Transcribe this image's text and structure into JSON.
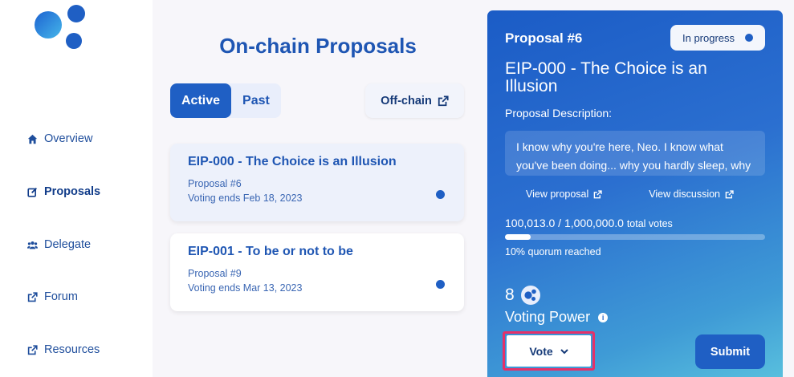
{
  "sidebar": {
    "logo_icon": "logo-circles-icon",
    "items": [
      {
        "label": "Overview",
        "icon": "home-icon"
      },
      {
        "label": "Proposals",
        "icon": "edit-icon",
        "active": true
      },
      {
        "label": "Delegate",
        "icon": "users-icon"
      },
      {
        "label": "Forum",
        "icon": "external-link-icon"
      },
      {
        "label": "Resources",
        "icon": "external-link-icon"
      }
    ]
  },
  "main": {
    "title": "On-chain Proposals",
    "tabs": [
      {
        "label": "Active",
        "active": true
      },
      {
        "label": "Past",
        "active": false
      }
    ],
    "offchain_label": "Off-chain",
    "proposals": [
      {
        "title": "EIP-000 - The Choice is an Illusion",
        "number": "Proposal #6",
        "ends": "Voting ends Feb 18, 2023",
        "selected": true
      },
      {
        "title": "EIP-001 - To be or not to be",
        "number": "Proposal #9",
        "ends": "Voting ends Mar 13, 2023",
        "selected": false
      }
    ]
  },
  "panel": {
    "number": "Proposal #6",
    "status": "In progress",
    "title": "EIP-000 - The Choice is an Illusion",
    "desc_label": "Proposal Description:",
    "description": "I know why you're here, Neo. I know what you've been doing... why you hardly sleep, why you live alone, and why night after night",
    "view_proposal": "View proposal",
    "view_discussion": "View discussion",
    "votes": "100,013.0 / 1,000,000.0",
    "votes_suffix": "total votes",
    "quorum_text": "10% quorum reached",
    "quorum_fraction": 0.1,
    "voting_power_value": "8",
    "voting_power_label": "Voting Power",
    "vote_label": "Vote",
    "submit_label": "Submit",
    "colors": {
      "accent": "#1f5fc4",
      "highlight": "#e53169"
    }
  }
}
